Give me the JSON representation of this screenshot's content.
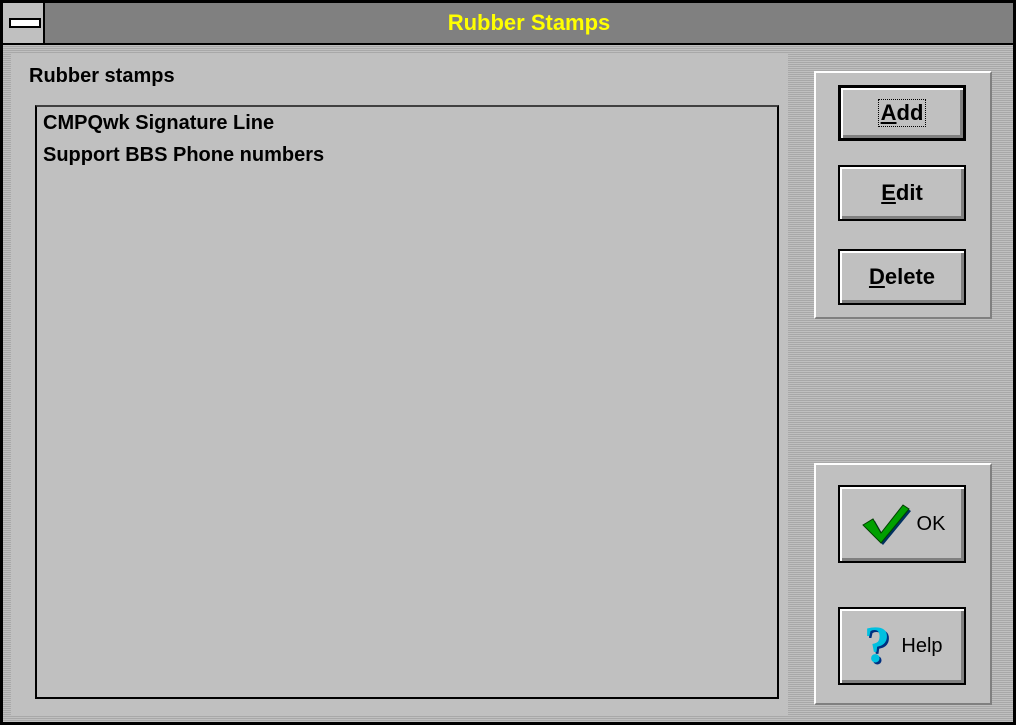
{
  "window": {
    "title": "Rubber Stamps"
  },
  "list": {
    "label": "Rubber stamps",
    "items": [
      "CMPQwk Signature Line",
      "Support BBS Phone numbers"
    ]
  },
  "buttons": {
    "add": "Add",
    "edit": "Edit",
    "delete": "Delete",
    "ok": "OK",
    "help": "Help"
  },
  "icons": {
    "ok": "checkmark-icon",
    "help": "question-mark-icon"
  },
  "colors": {
    "title_text": "#ffff00",
    "title_bar": "#808080",
    "face": "#c0c0c0",
    "check_green": "#00a000",
    "help_cyan": "#00c0e0"
  }
}
